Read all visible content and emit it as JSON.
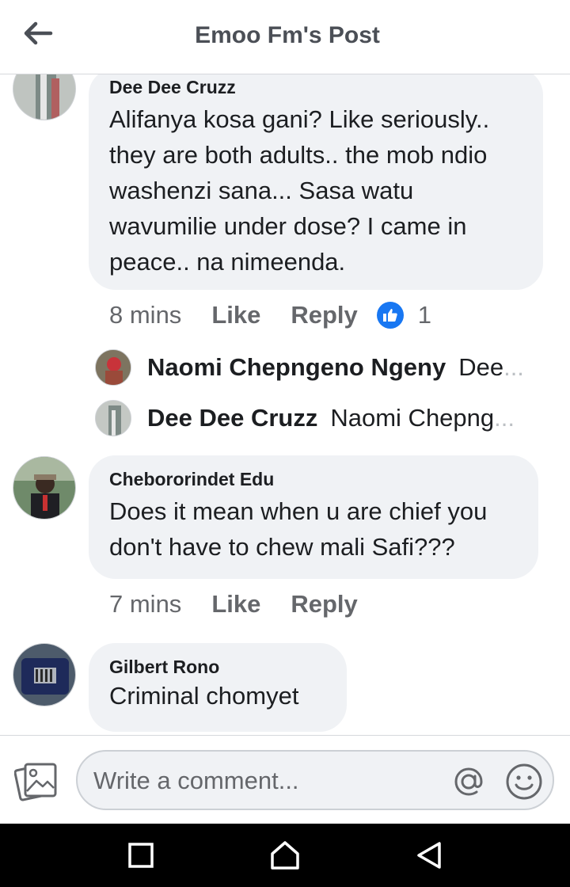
{
  "header": {
    "title": "Emoo Fm's Post",
    "back_icon": "arrow-left-icon"
  },
  "comments": [
    {
      "author": "Dee Dee Cruzz",
      "text": "Alifanya kosa gani? Like seriously.. they are both adults.. the mob ndio washenzi sana... Sasa watu wavumilie under dose? I came in peace.. na nimeenda.",
      "time": "8 mins",
      "like_label": "Like",
      "reply_label": "Reply",
      "reaction_count": "1",
      "replies": [
        {
          "author": "Naomi Chepngeno Ngeny",
          "snippet": "Dee",
          "ellipsis": "..."
        },
        {
          "author": "Dee Dee Cruzz",
          "snippet": "Naomi Chepng",
          "ellipsis": "..."
        }
      ]
    },
    {
      "author": "Chebororindet Edu",
      "text": "Does it mean when u are chief you don't have to chew mali Safi???",
      "time": "7 mins",
      "like_label": "Like",
      "reply_label": "Reply"
    },
    {
      "author": "Gilbert Rono",
      "text": "Criminal chomyet"
    }
  ],
  "composer": {
    "placeholder": "Write a comment..."
  },
  "colors": {
    "accent": "#1877f2",
    "bubble": "#f0f2f5",
    "muted": "#65676b"
  }
}
